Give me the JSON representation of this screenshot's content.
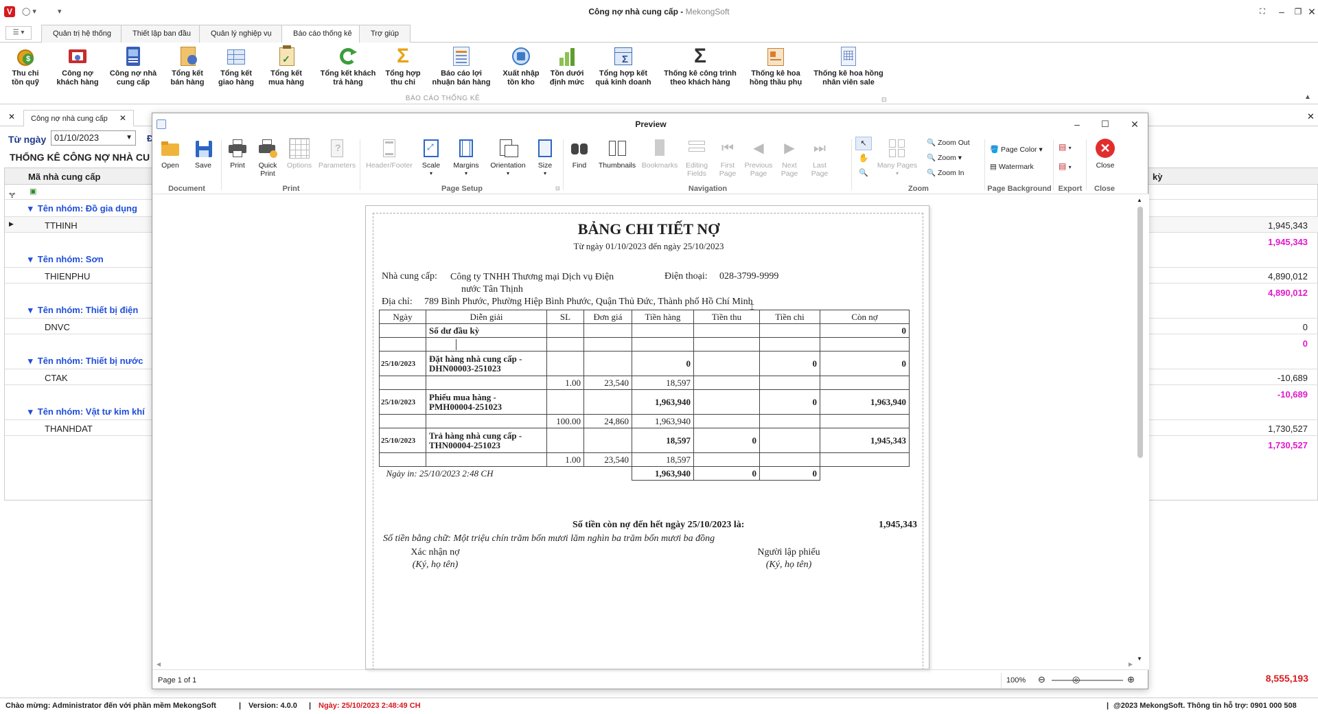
{
  "app": {
    "title": "Công nợ nhà cung cấp",
    "brand": "MekongSoft",
    "logo": "V"
  },
  "menu": {
    "toggle": "☰ ▾",
    "tabs": [
      "Quản trị hệ thống",
      "Thiết lập ban đầu",
      "Quản lý nghiệp vụ",
      "Báo cáo thống kê",
      "Trợ giúp"
    ],
    "active_index": 3
  },
  "ribbon": {
    "group_label": "BÁO CÁO THỐNG KÊ",
    "buttons": [
      {
        "l1": "Thu chi",
        "l2": "tồn quỹ",
        "icon": "cash-coins-icon"
      },
      {
        "l1": "Công nợ",
        "l2": "khách hàng",
        "icon": "customer-debt-icon"
      },
      {
        "l1": "Công nợ nhà",
        "l2": "cung cấp",
        "icon": "supplier-debt-icon"
      },
      {
        "l1": "Tổng kết",
        "l2": "bán hàng",
        "icon": "sales-summary-icon"
      },
      {
        "l1": "Tổng kết",
        "l2": "giao hàng",
        "icon": "delivery-summary-icon"
      },
      {
        "l1": "Tổng kết",
        "l2": "mua hàng",
        "icon": "purchase-summary-icon"
      },
      {
        "l1": "Tổng kết khách",
        "l2": "trả hàng",
        "icon": "customer-return-icon"
      },
      {
        "l1": "Tổng hợp",
        "l2": "thu chi",
        "icon": "sigma-gold-icon"
      },
      {
        "l1": "Báo cáo lợi",
        "l2": "nhuận bán hàng",
        "icon": "profit-report-icon"
      },
      {
        "l1": "Xuất nhập",
        "l2": "tồn kho",
        "icon": "inventory-icon"
      },
      {
        "l1": "Tồn dưới",
        "l2": "định mức",
        "icon": "low-stock-chart-icon"
      },
      {
        "l1": "Tổng hợp kết",
        "l2": "quả kinh doanh",
        "icon": "business-result-icon"
      },
      {
        "l1": "Thống kê công trình",
        "l2": "theo khách hàng",
        "icon": "sigma-icon"
      },
      {
        "l1": "Thống kê hoa",
        "l2": "hồng thầu phụ",
        "icon": "subcontractor-commission-icon"
      },
      {
        "l1": "Thống kê hoa hồng",
        "l2": "nhân viên sale",
        "icon": "sales-commission-icon"
      }
    ]
  },
  "doc_tab": {
    "label": "Công nợ nhà cung cấp"
  },
  "report_bg": {
    "from_label": "Từ ngày",
    "from_value": "01/10/2023",
    "heading": "THỐNG KÊ CÔNG NỢ NHÀ CU",
    "col_supplier": "Mã nhà cung cấp",
    "col_right": "kỳ",
    "groups": [
      {
        "name": "Tên nhóm: Đồ gia dụng",
        "code": "TTHINH",
        "amount": "1,945,343",
        "subtotal": "1,945,343"
      },
      {
        "name": "Tên nhóm: Sơn",
        "code": "THIENPHU",
        "amount": "4,890,012",
        "subtotal": "4,890,012"
      },
      {
        "name": "Tên nhóm: Thiết bị điện",
        "code": "DNVC",
        "amount": "0",
        "subtotal": "0"
      },
      {
        "name": "Tên nhóm: Thiết bị nước",
        "code": "CTAK",
        "amount": "-10,689",
        "subtotal": "-10,689"
      },
      {
        "name": "Tên nhóm: Vật tư kim khí",
        "code": "THANHDAT",
        "amount": "1,730,527",
        "subtotal": "1,730,527"
      }
    ],
    "grand_total": "8,555,193"
  },
  "status": {
    "welcome": "Chào mừng: Administrator đến với phần mềm MekongSoft",
    "version": "Version: 4.0.0",
    "date": "Ngày: 25/10/2023 2:48:49 CH",
    "copyright": "@2023 MekongSoft. Thông tin hỗ trợ: 0901 000 508"
  },
  "preview": {
    "title": "Preview",
    "toolbar": {
      "open": "Open",
      "save": "Save",
      "print": "Print",
      "quick_print_1": "Quick",
      "quick_print_2": "Print",
      "options": "Options",
      "parameters": "Parameters",
      "header_footer": "Header/Footer",
      "scale": "Scale",
      "margins": "Margins",
      "orientation": "Orientation",
      "size": "Size",
      "find": "Find",
      "thumbnails": "Thumbnails",
      "bookmarks": "Bookmarks",
      "editing_1": "Editing",
      "editing_2": "Fields",
      "first_1": "First",
      "first_2": "Page",
      "prev_1": "Previous",
      "prev_2": "Page",
      "next_1": "Next",
      "next_2": "Page",
      "last_1": "Last",
      "last_2": "Page",
      "many_pages": "Many Pages",
      "zoom_out": "Zoom Out",
      "zoom": "Zoom",
      "zoom_in": "Zoom In",
      "page_color": "Page Color",
      "watermark": "Watermark",
      "close": "Close"
    },
    "groups": [
      "Document",
      "Print",
      "Page Setup",
      "Navigation",
      "Zoom",
      "Page Background",
      "Export",
      "Close"
    ],
    "page_info": "Page 1 of 1",
    "zoom_level": "100%"
  },
  "report": {
    "title": "BẢNG CHI TIẾT NỢ",
    "date_range": "Từ ngày 01/10/2023 đến ngày 25/10/2023",
    "supplier_label": "Nhà cung cấp:",
    "supplier_line1": "Công ty TNHH Thương mại Dịch vụ Điện",
    "supplier_line2": "nước Tân Thịnh",
    "phone_label": "Điện thoại:",
    "phone": "028-3799-9999",
    "address_label": "Địa chỉ:",
    "address": "789 Bình Phước, Phường Hiệp Bình Phước, Quận Thủ Đức, Thành phố Hồ Chí Minh",
    "columns": [
      "Ngày",
      "Diễn giải",
      "SL",
      "Đơn giá",
      "Tiền hàng",
      "Tiền thu",
      "Tiền chi",
      "Còn nợ"
    ],
    "opening_label": "Số dư đầu kỳ",
    "opening_value": "0",
    "transactions": [
      {
        "date": "25/10/2023",
        "desc1": "Đặt hàng nhà cung cấp -",
        "desc2": "DHN00003-251023",
        "tien_hang": "0",
        "tien_thu": "",
        "tien_chi": "0",
        "con_no": "0",
        "detail": {
          "sl": "1.00",
          "don_gia": "23,540",
          "tien_hang": "18,597"
        }
      },
      {
        "date": "25/10/2023",
        "desc1": "Phiếu mua hàng -",
        "desc2": "PMH00004-251023",
        "tien_hang": "1,963,940",
        "tien_thu": "",
        "tien_chi": "0",
        "con_no": "1,963,940",
        "detail": {
          "sl": "100.00",
          "don_gia": "24,860",
          "tien_hang": "1,963,940"
        }
      },
      {
        "date": "25/10/2023",
        "desc1": "Trả hàng nhà cung cấp -",
        "desc2": "THN00004-251023",
        "tien_hang": "18,597",
        "tien_thu": "0",
        "tien_chi": "",
        "con_no": "1,945,343",
        "detail": {
          "sl": "1.00",
          "don_gia": "23,540",
          "tien_hang": "18,597"
        }
      }
    ],
    "print_date": "Ngày in: 25/10/2023 2:48 CH",
    "total_hang": "1,963,940",
    "total_thu": "0",
    "total_chi": "0",
    "balance_label": "Số tiền còn nợ đến hết ngày 25/10/2023 là:",
    "balance_value": "1,945,343",
    "in_words": "Số tiền bằng chữ: Một triệu chín trăm bốn mươi lăm nghìn ba trăm bốn mươi ba đồng",
    "sign_left": "Xác nhận nợ",
    "sign_left_sub": "(Ký, họ tên)",
    "sign_right": "Người lập phiếu",
    "sign_right_sub": "(Ký, họ tên)"
  }
}
